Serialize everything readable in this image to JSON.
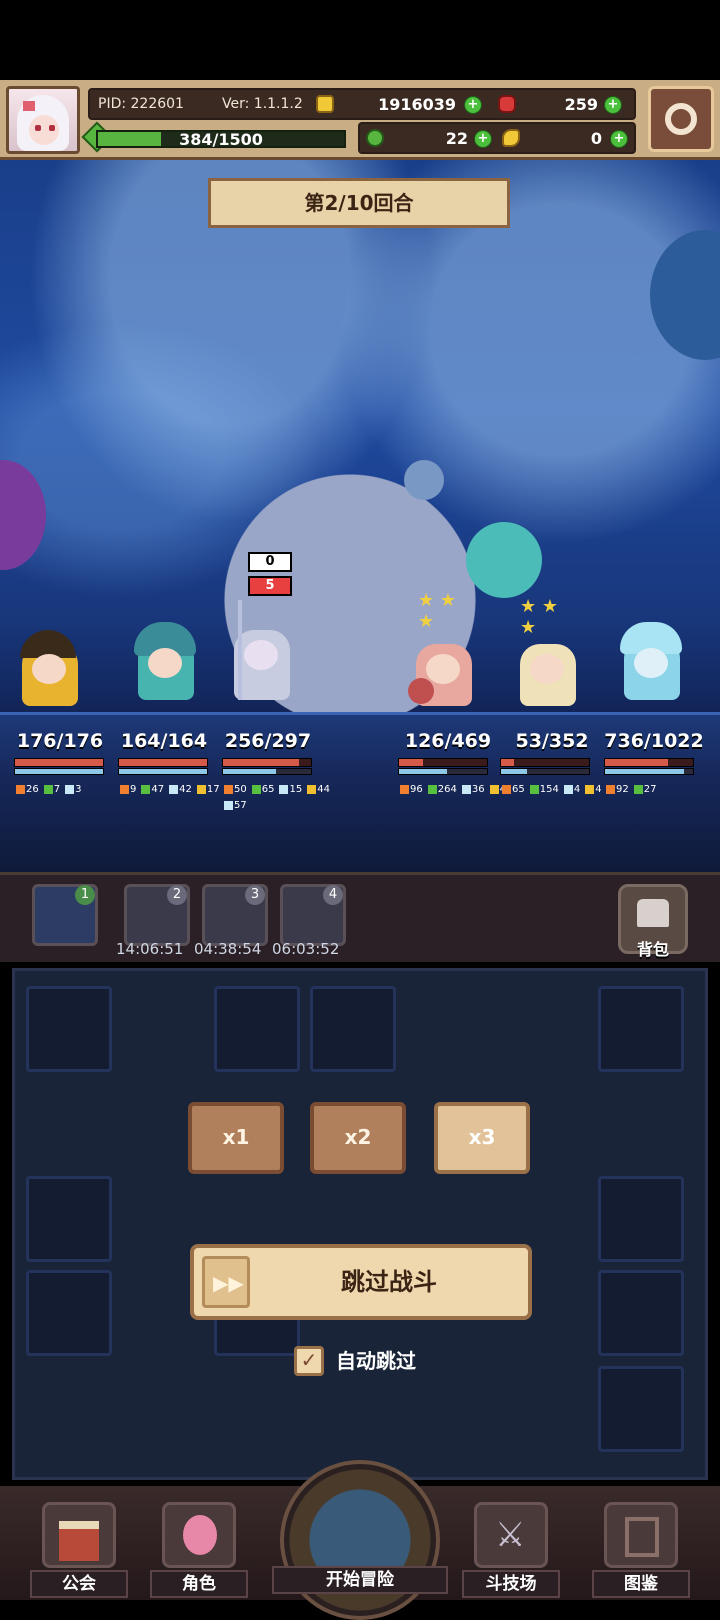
{
  "header": {
    "pid": "PID: 222601",
    "version": "Ver: 1.1.1.2",
    "gold": "1916039",
    "gems": "259",
    "exp_text": "384/1500",
    "exp_fraction": 0.256,
    "clover": "22",
    "key_item": "0"
  },
  "battle": {
    "round_label": "第2/10回合",
    "status_badge_top": "0",
    "status_badge_bottom": "5",
    "heroes": [
      {
        "hp": "176/176",
        "hp_frac": 1.0,
        "mp_frac": 1.0,
        "stats": [
          "26",
          "7",
          "3"
        ]
      },
      {
        "hp": "164/164",
        "hp_frac": 1.0,
        "mp_frac": 1.0,
        "stats": [
          "9",
          "47",
          "42",
          "17"
        ]
      },
      {
        "hp": "256/297",
        "hp_frac": 0.86,
        "mp_frac": 0.6,
        "stats": [
          "50",
          "65",
          "15",
          "44"
        ],
        "stats2": [
          "57"
        ]
      }
    ],
    "enemies": [
      {
        "hp": "126/469",
        "hp_frac": 0.27,
        "mp_frac": 0.55,
        "stats": [
          "96",
          "264",
          "36",
          "4"
        ]
      },
      {
        "hp": "53/352",
        "hp_frac": 0.15,
        "mp_frac": 0.3,
        "stats": [
          "65",
          "154",
          "4",
          "4"
        ]
      },
      {
        "hp": "736/1022",
        "hp_frac": 0.72,
        "mp_frac": 0.9,
        "stats": [
          "92",
          "27"
        ]
      }
    ]
  },
  "slots": [
    {
      "num": "1",
      "timer": ""
    },
    {
      "num": "2",
      "timer": "14:06:51"
    },
    {
      "num": "3",
      "timer": "04:38:54"
    },
    {
      "num": "4",
      "timer": "06:03:52"
    }
  ],
  "bag_label": "背包",
  "speed": {
    "x1": "x1",
    "x2": "x2",
    "x3": "x3"
  },
  "skip_label": "跳过战斗",
  "auto_skip_label": "自动跳过",
  "auto_skip_checked": true,
  "nav": {
    "guild": "公会",
    "character": "角色",
    "adventure": "开始冒险",
    "arena": "斗技场",
    "codex": "图鉴"
  },
  "colors": {
    "hp": "#d65a4a",
    "mp": "#8ec8e8",
    "exp": "#58b640",
    "accent": "#e8d2a8"
  }
}
